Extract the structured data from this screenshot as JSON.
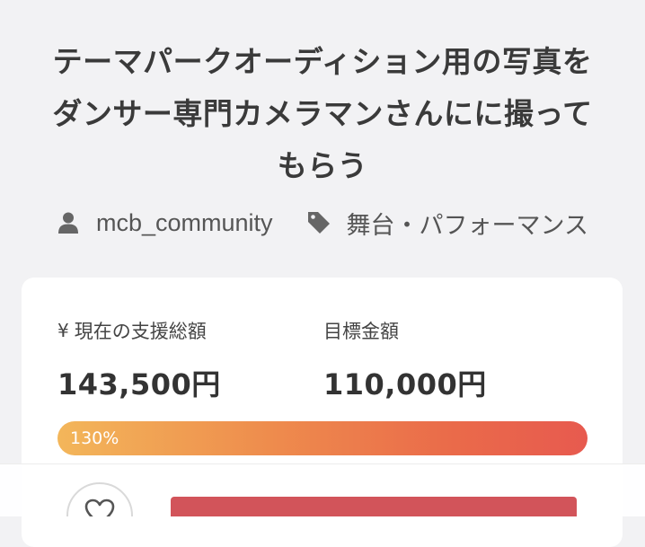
{
  "project": {
    "title_line1": "テーマパークオーディション用の写真を",
    "title_line2": "ダンサー専門カメラマンさんにに撮って",
    "title_line3": "もらう",
    "author": "mcb_community",
    "category": "舞台・パフォーマンス"
  },
  "funding": {
    "current_label": "現在の支援総額",
    "current_amount": "143,500円",
    "goal_label": "目標金額",
    "goal_amount": "110,000円",
    "progress_text": "130%",
    "progress_percent": 130
  },
  "icons": {
    "author": "user-icon",
    "category": "tag-icon",
    "currency": "yen-icon",
    "like": "heart-icon"
  },
  "colors": {
    "background": "#f2f2f4",
    "card": "#ffffff",
    "progress_start": "#f3b65a",
    "progress_end": "#e75a4f",
    "support_button": "#d2545a"
  }
}
